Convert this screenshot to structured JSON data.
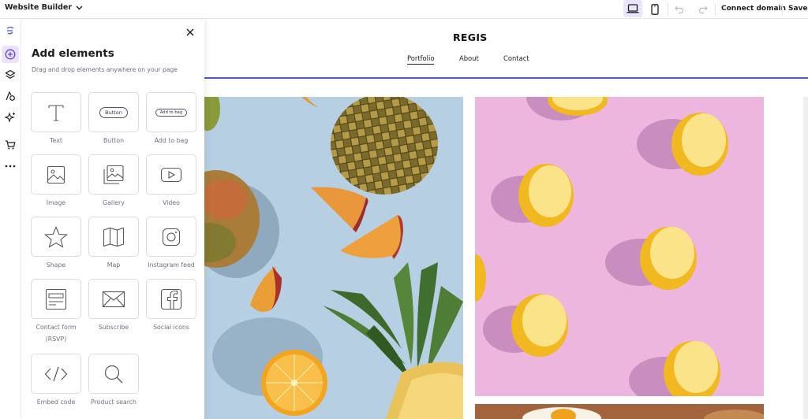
{
  "app": {
    "title": "Website Builder",
    "accent": "#673de6",
    "connect_domain": "Connect domain",
    "save": "Save"
  },
  "toolbar": {
    "icons": [
      "desktop-icon",
      "mobile-icon",
      "undo-icon",
      "redo-icon"
    ],
    "active_view": "desktop"
  },
  "rail": {
    "items": [
      "logo-icon",
      "add-elements-icon",
      "layers-icon",
      "styles-icon",
      "ai-tools-icon",
      "store-icon",
      "more-icon"
    ],
    "active": "add-elements-icon"
  },
  "panel": {
    "title": "Add elements",
    "subtitle": "Drag and drop elements anywhere on your page",
    "tiles": [
      {
        "label": "Text",
        "icon": "text-icon",
        "preview": "T"
      },
      {
        "label": "Button",
        "icon": "button-icon",
        "preview": "Button"
      },
      {
        "label": "Add to bag",
        "icon": "add-to-bag-icon",
        "preview": "Add to bag"
      },
      {
        "label": "Image",
        "icon": "image-icon"
      },
      {
        "label": "Gallery",
        "icon": "gallery-icon"
      },
      {
        "label": "Video",
        "icon": "video-icon"
      },
      {
        "label": "Shape",
        "icon": "shape-icon"
      },
      {
        "label": "Map",
        "icon": "map-icon"
      },
      {
        "label": "Instagram feed",
        "icon": "instagram-icon"
      },
      {
        "label": "Contact form (RSVP)",
        "label_line1": "Contact form",
        "label_line2": "(RSVP)",
        "icon": "contact-form-icon"
      },
      {
        "label": "Subscribe",
        "icon": "subscribe-icon"
      },
      {
        "label": "Social icons",
        "icon": "social-icons-icon"
      },
      {
        "label": "Embed code",
        "icon": "embed-code-icon"
      },
      {
        "label": "Product search",
        "icon": "product-search-icon"
      }
    ]
  },
  "site": {
    "title": "REGIS",
    "nav": [
      "Portfolio",
      "About",
      "Contact"
    ],
    "active_nav": "Portfolio",
    "header_line_color": "#4a5bb8",
    "photos": [
      {
        "name": "fruit-photo",
        "background": "#b7cfe2"
      },
      {
        "name": "lemon-photo",
        "background": "#ecb6de"
      },
      {
        "name": "egg-photo",
        "background": "#a1643c"
      }
    ]
  }
}
